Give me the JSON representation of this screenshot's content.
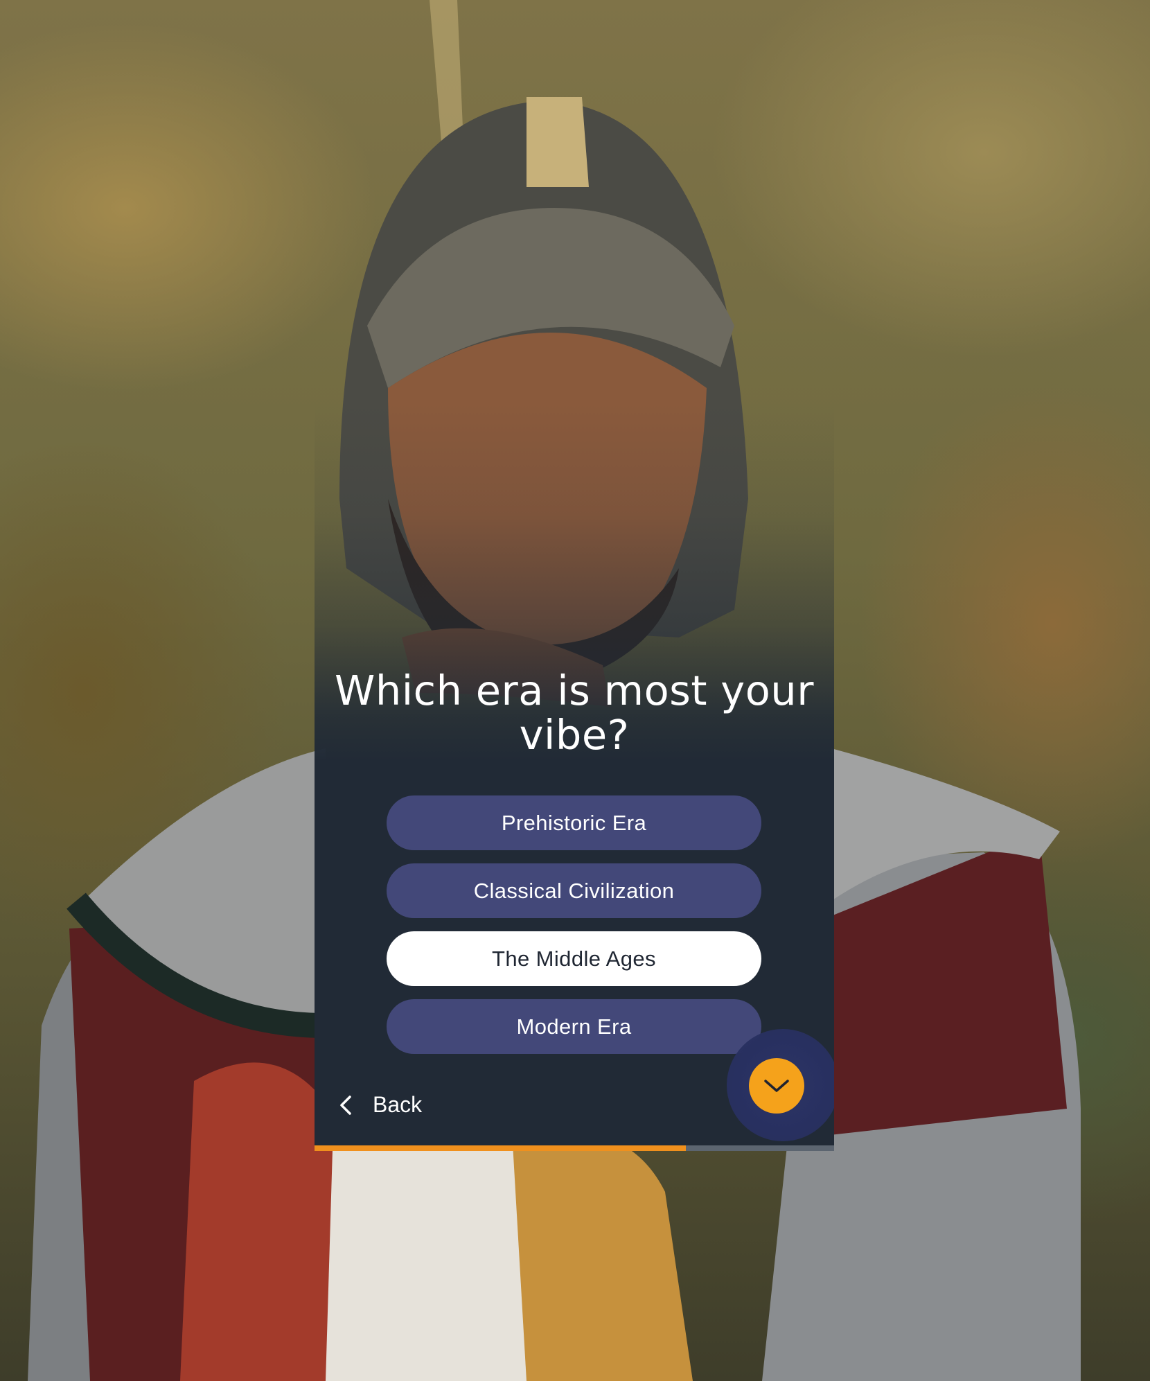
{
  "background": {
    "image_subject": "knight-in-helmet-photo"
  },
  "quiz": {
    "question": "Which era is most your vibe?",
    "options": [
      {
        "label": "Prehistoric Era",
        "selected": false
      },
      {
        "label": "Classical Civilization",
        "selected": false
      },
      {
        "label": "The Middle Ages",
        "selected": true
      },
      {
        "label": "Modern Era",
        "selected": false
      }
    ],
    "back_label": "Back",
    "next_icon": "chevron-down-icon",
    "back_icon": "chevron-left-icon",
    "progress_fraction": 0.715
  },
  "colors": {
    "card_bg": "#212a36",
    "option_bg": "#434879",
    "option_selected_bg": "#ffffff",
    "accent": "#f5a21b",
    "progress_fill": "#f0901d",
    "progress_track": "#5c6570"
  }
}
